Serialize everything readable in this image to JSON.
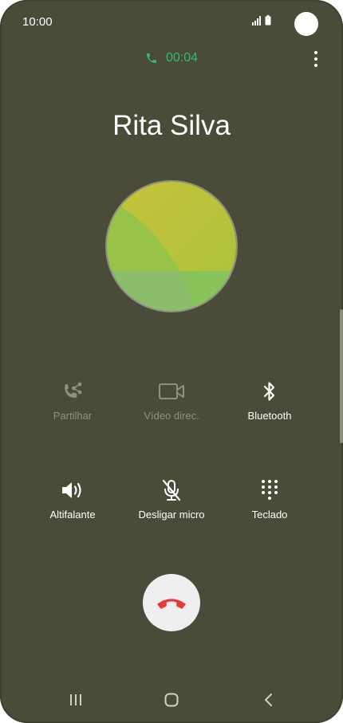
{
  "status_bar": {
    "time": "10:00"
  },
  "call": {
    "duration": "00:04",
    "contact_name": "Rita Silva"
  },
  "actions": {
    "share": "Partilhar",
    "video": "Vídeo direc.",
    "bluetooth": "Bluetooth",
    "speaker": "Altifalante",
    "mute": "Desligar micro",
    "keypad": "Teclado"
  },
  "colors": {
    "background": "#4a4c39",
    "timer_green": "#2fbf71",
    "end_call_red": "#e53a3a",
    "disabled_text": "#8f917f"
  },
  "icons": {
    "share": "share-call-icon",
    "video": "video-camera-icon",
    "bluetooth": "bluetooth-icon",
    "speaker": "speaker-icon",
    "mute": "mic-off-icon",
    "keypad": "keypad-icon",
    "end_call": "end-call-icon",
    "nav_recents": "recents-icon",
    "nav_home": "home-icon",
    "nav_back": "back-icon"
  }
}
